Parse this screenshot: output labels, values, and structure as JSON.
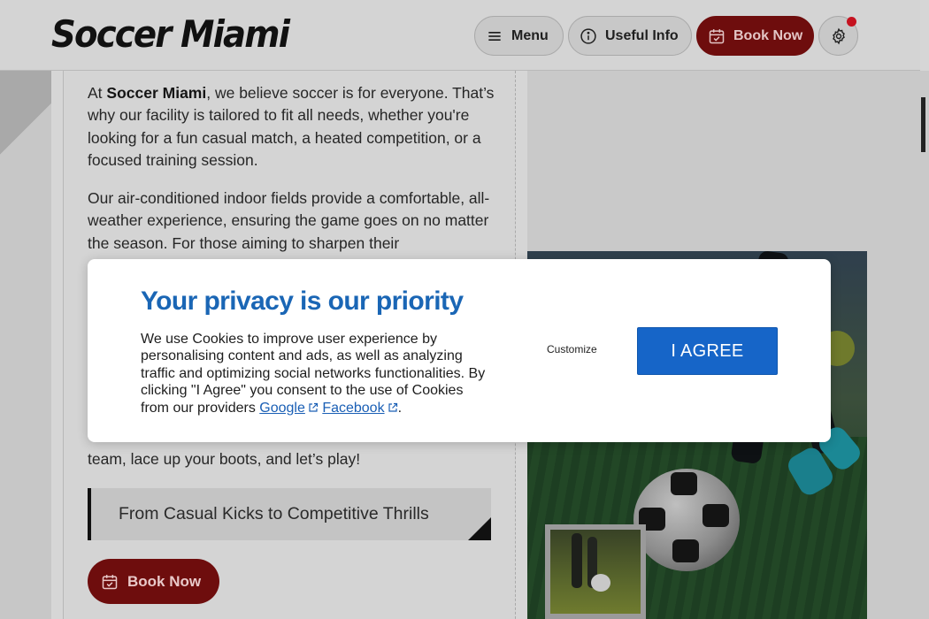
{
  "header": {
    "logo_text": "Soccer Miami",
    "menu_label": "Menu",
    "useful_info_label": "Useful Info",
    "book_now_label": "Book Now"
  },
  "content": {
    "para1_prefix": "At ",
    "para1_brand": "Soccer Miami",
    "para1_rest": ", we believe soccer is for everyone. That’s why our facility is tailored to fit all needs, whether you're looking for a fun casual match, a heated competition, or a focused training session.",
    "para2": "Our air-conditioned indoor fields provide a comfortable, all-weather experience, ensuring the game goes on no matter the season. For those aiming to sharpen their",
    "para3_partial": "team, lace up your boots, and let’s play!",
    "subheading": "From Casual Kicks to Competitive Thrills",
    "book_now_label": "Book Now"
  },
  "cookie_modal": {
    "title": "Your privacy is our priority",
    "body": "We use Cookies to improve user experience by personalising content and ads, as well as analyzing traffic and optimizing social networks functionalities. By clicking \"I Agree\" you consent to the use of Cookies from our providers ",
    "google_link": "Google",
    "facebook_link": "Facebook",
    "period": ".",
    "customize_label": "Customize",
    "agree_label": "I AGREE"
  },
  "colors": {
    "brand_red": "#6e0d0d",
    "accent_blue": "#1665c8",
    "title_blue": "#1a66b5",
    "notification": "#c5121f"
  },
  "icons": [
    "menu-icon",
    "info-icon",
    "calendar-check-icon",
    "gear-icon",
    "external-link-icon"
  ]
}
